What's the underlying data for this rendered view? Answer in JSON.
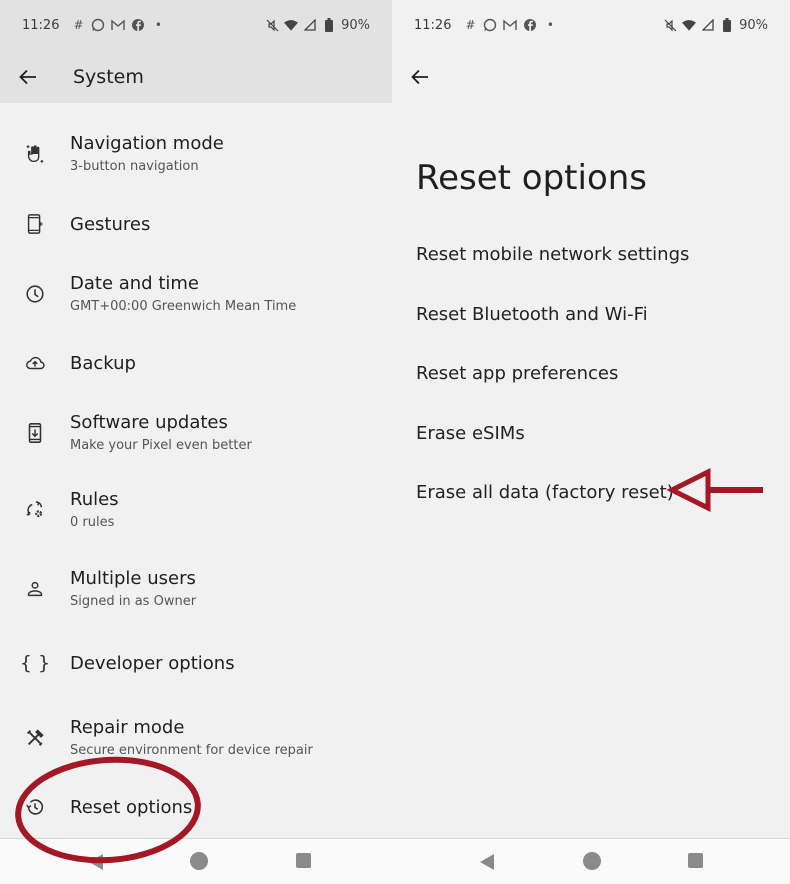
{
  "status_bar": {
    "time": "11:26",
    "notification_icons": [
      "slack-icon",
      "whatsapp-icon",
      "gmail-icon",
      "facebook-icon",
      "more-dot-icon"
    ],
    "battery": "90%",
    "system_icons": [
      "mute-icon",
      "wifi-icon",
      "signal-icon",
      "battery-icon"
    ]
  },
  "left_screen": {
    "title": "System",
    "items": [
      {
        "icon": "gesture-hand-icon",
        "title": "Navigation mode",
        "subtitle": "3-button navigation"
      },
      {
        "icon": "phone-gesture-icon",
        "title": "Gestures",
        "subtitle": ""
      },
      {
        "icon": "clock-icon",
        "title": "Date and time",
        "subtitle": "GMT+00:00 Greenwich Mean Time"
      },
      {
        "icon": "cloud-upload-icon",
        "title": "Backup",
        "subtitle": ""
      },
      {
        "icon": "system-update-icon",
        "title": "Software updates",
        "subtitle": "Make your Pixel even better"
      },
      {
        "icon": "rules-icon",
        "title": "Rules",
        "subtitle": "0 rules"
      },
      {
        "icon": "person-icon",
        "title": "Multiple users",
        "subtitle": "Signed in as Owner"
      },
      {
        "icon": "code-braces-icon",
        "title": "Developer options",
        "subtitle": ""
      },
      {
        "icon": "repair-tools-icon",
        "title": "Repair mode",
        "subtitle": "Secure environment for device repair"
      },
      {
        "icon": "history-icon",
        "title": "Reset options",
        "subtitle": ""
      }
    ]
  },
  "right_screen": {
    "title": "Reset options",
    "options": [
      "Reset mobile network settings",
      "Reset Bluetooth and Wi-Fi",
      "Reset app preferences",
      "Erase eSIMs",
      "Erase all data (factory reset)"
    ]
  },
  "annotations": {
    "color": "#a31824",
    "circle_target": "Reset options",
    "arrow_target": "Erase all data (factory reset)"
  }
}
